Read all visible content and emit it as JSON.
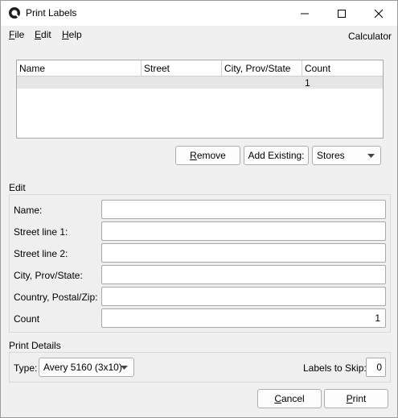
{
  "window": {
    "title": "Print Labels",
    "minimize_icon": "minimize-icon",
    "maximize_icon": "maximize-icon",
    "close_icon": "close-icon"
  },
  "menu": {
    "items": [
      {
        "label": "File",
        "accel": "F",
        "rest": "ile"
      },
      {
        "label": "Edit",
        "accel": "E",
        "rest": "dit"
      },
      {
        "label": "Help",
        "accel": "H",
        "rest": "elp"
      }
    ],
    "calculator": "Calculator"
  },
  "table": {
    "columns": [
      "Name",
      "Street",
      "City, Prov/State",
      "Count"
    ],
    "rows": [
      {
        "name": "",
        "street": "",
        "city": "",
        "count": "1"
      }
    ]
  },
  "list_actions": {
    "remove": {
      "accel": "R",
      "rest": "emove"
    },
    "add_existing": "Add Existing:",
    "source_select": "Stores"
  },
  "edit": {
    "title": "Edit",
    "fields": [
      {
        "label": "Name:",
        "value": ""
      },
      {
        "label": "Street line 1:",
        "value": ""
      },
      {
        "label": "Street line 2:",
        "value": ""
      },
      {
        "label": "City, Prov/State:",
        "value": ""
      },
      {
        "label": "Country, Postal/Zip:",
        "value": ""
      },
      {
        "label": "Count",
        "value": "1"
      }
    ]
  },
  "print_details": {
    "title": "Print Details",
    "type_label": "Type:",
    "type_value": "Avery 5160 (3x10)",
    "skip_label": "Labels to Skip:",
    "skip_value": "0"
  },
  "dialog_buttons": {
    "cancel": {
      "accel": "C",
      "rest": "ancel"
    },
    "print": {
      "accel": "P",
      "rest": "rint"
    }
  }
}
